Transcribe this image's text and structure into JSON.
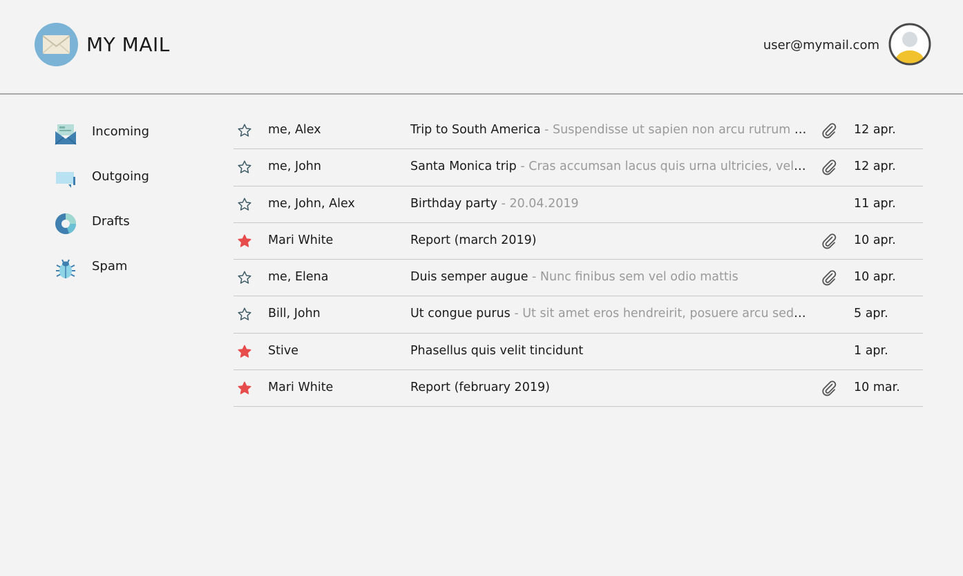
{
  "app": {
    "title": "MY MAIL"
  },
  "user": {
    "email": "user@mymail.com"
  },
  "sidebar": {
    "items": [
      {
        "label": "Incoming",
        "icon": "inbox-icon"
      },
      {
        "label": "Outgoing",
        "icon": "outgoing-chat-icon"
      },
      {
        "label": "Drafts",
        "icon": "drafts-pie-icon"
      },
      {
        "label": "Spam",
        "icon": "bug-icon"
      }
    ]
  },
  "mails": [
    {
      "starred": false,
      "sender": "me, Alex",
      "subject": "Trip to South America",
      "snippet": "Suspendisse ut sapien non arcu rutrum in ultricies metus",
      "attachment": true,
      "date": "12 apr."
    },
    {
      "starred": false,
      "sender": "me, John",
      "subject": "Santa Monica trip",
      "snippet": "Cras accumsan lacus quis urna ultricies, vel laoreet nisi",
      "attachment": true,
      "date": "12 apr."
    },
    {
      "starred": false,
      "sender": "me, John, Alex",
      "subject": "Birthday party",
      "snippet": "20.04.2019",
      "attachment": false,
      "date": "11 apr."
    },
    {
      "starred": true,
      "sender": "Mari White",
      "subject": "Report (march 2019)",
      "snippet": "",
      "attachment": true,
      "date": "10 apr."
    },
    {
      "starred": false,
      "sender": "me, Elena",
      "subject": "Duis semper augue",
      "snippet": "Nunc finibus sem vel odio mattis",
      "attachment": true,
      "date": "10 apr."
    },
    {
      "starred": false,
      "sender": "Bill, John",
      "subject": "Ut congue purus",
      "snippet": "Ut sit amet eros hendreirit, posuere arcu sed, luctus nunc",
      "attachment": false,
      "date": "5 apr."
    },
    {
      "starred": true,
      "sender": "Stive",
      "subject": "Phasellus quis velit tincidunt",
      "snippet": "",
      "attachment": false,
      "date": "1 apr."
    },
    {
      "starred": true,
      "sender": "Mari White",
      "subject": "Report (february 2019)",
      "snippet": "",
      "attachment": true,
      "date": "10 mar."
    }
  ],
  "colors": {
    "background": "#f3f3f3",
    "star_active": "#e74c4c",
    "star_inactive": "#3d5a66",
    "logo_bg": "#7ab3d6",
    "avatar_accent": "#f2c12e"
  }
}
